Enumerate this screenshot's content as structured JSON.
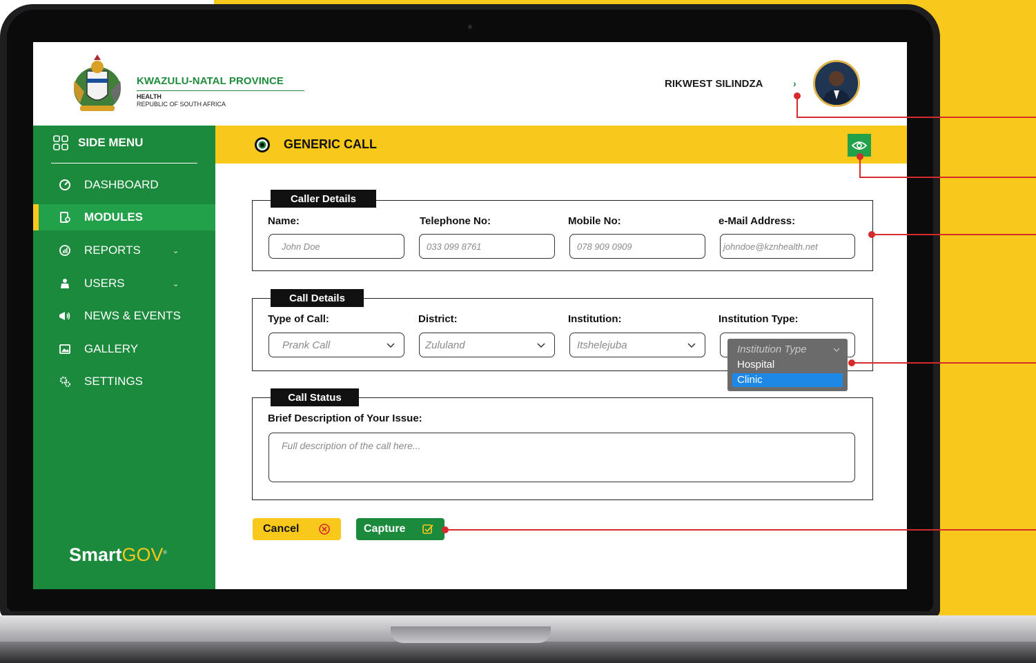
{
  "header": {
    "province_title": "KWAZULU-NATAL PROVINCE",
    "department": "HEALTH",
    "country": "REPUBLIC OF SOUTH AFRICA",
    "user_name": "RIKWEST SILINDZA",
    "user_chevron": "›"
  },
  "sidebar": {
    "title": "SIDE MENU",
    "items": [
      {
        "label": "DASHBOARD",
        "icon": "gauge-icon"
      },
      {
        "label": "MODULES",
        "icon": "modules-icon",
        "active": true
      },
      {
        "label": "REPORTS",
        "icon": "reports-icon",
        "has_submenu": true
      },
      {
        "label": "USERS",
        "icon": "users-icon",
        "has_submenu": true
      },
      {
        "label": "NEWS & EVENTS",
        "icon": "megaphone-icon"
      },
      {
        "label": "GALLERY",
        "icon": "gallery-icon"
      },
      {
        "label": "SETTINGS",
        "icon": "settings-icon"
      }
    ],
    "submenu_chevron": "⌄",
    "brand_bold": "Smart",
    "brand_light": "GOV",
    "brand_mark": "®"
  },
  "content": {
    "title": "GENERIC CALL",
    "view_icon": "eye-icon"
  },
  "caller_details": {
    "legend": "Caller Details",
    "fields": [
      {
        "label": "Name:",
        "placeholder": "John Doe"
      },
      {
        "label": "Telephone No:",
        "placeholder": "033 099 8761"
      },
      {
        "label": "Mobile No:",
        "placeholder": "078 909 0909"
      },
      {
        "label": "e-Mail Address:",
        "placeholder": "johndoe@kznhealth.net"
      }
    ]
  },
  "call_details": {
    "legend": "Call Details",
    "fields": [
      {
        "label": "Type of Call:",
        "value": "Prank Call"
      },
      {
        "label": "District:",
        "value": "Zululand"
      },
      {
        "label": "Institution:",
        "value": "Itshelejuba"
      },
      {
        "label": "Institution Type:",
        "value": ""
      }
    ],
    "institution_type_dropdown": {
      "placeholder": "Institution Type",
      "options": [
        "Hospital",
        "Clinic"
      ],
      "highlighted": "Clinic"
    }
  },
  "call_status": {
    "legend": "Call Status",
    "label": "Brief Description of Your Issue:",
    "placeholder": "Full description of the call here..."
  },
  "actions": {
    "cancel_label": "Cancel",
    "capture_label": "Capture"
  },
  "colors": {
    "brand_green": "#1b8a3d",
    "brand_yellow": "#f8c81b",
    "annotation_red": "#d62b2b",
    "dropdown_highlight": "#1d88e5"
  }
}
